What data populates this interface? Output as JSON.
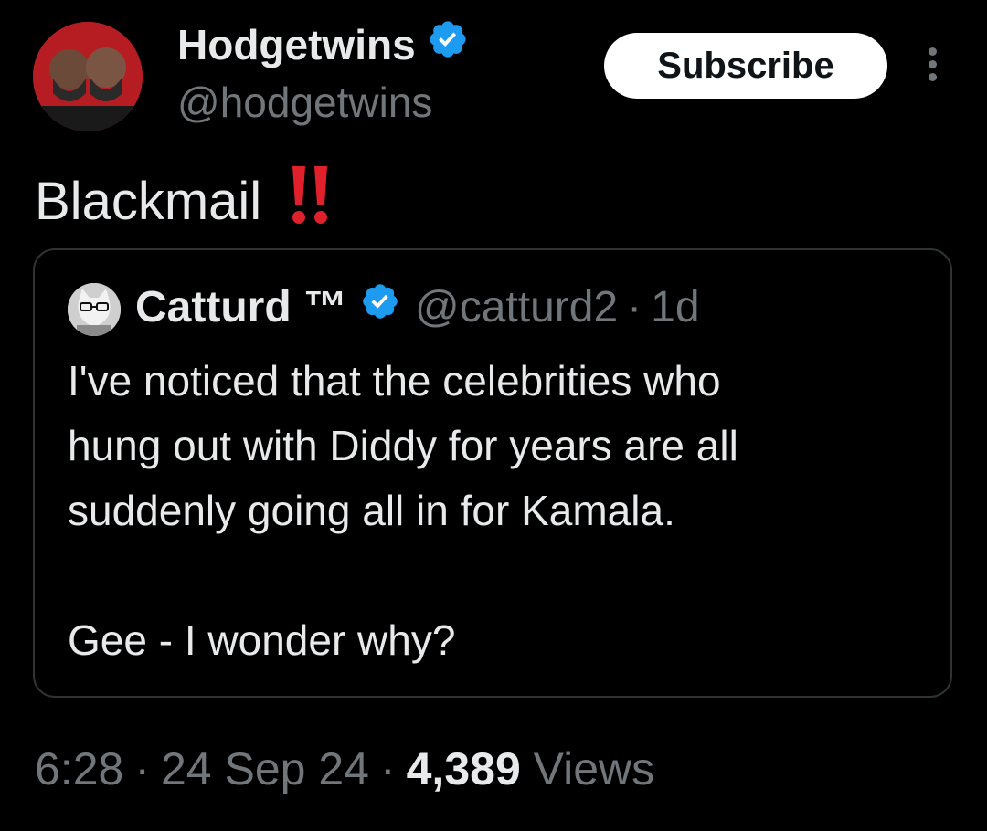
{
  "author": {
    "display_name": "Hodgetwins",
    "handle": "@hodgetwins",
    "verified_icon": "verified-badge-icon",
    "avatar_icon": "avatar-photo"
  },
  "actions": {
    "subscribe_label": "Subscribe",
    "more_icon": "more-vertical-icon"
  },
  "tweet": {
    "text": "Blackmail",
    "emoji_icon": "double-exclamation-icon"
  },
  "quote": {
    "display_name": "Catturd ™",
    "handle": "@catturd2",
    "separator": "·",
    "time": "1d",
    "lines": [
      "I've noticed that the celebrities who",
      "hung out with Diddy for years are all",
      "suddenly going all in for Kamala.",
      "Gee - I wonder why?"
    ]
  },
  "meta": {
    "time": "6:28",
    "date": "24 Sep 24",
    "views_count": "4,389",
    "views_label": "Views",
    "separator": "·"
  },
  "colors": {
    "background": "#000000",
    "text": "#e7e9ea",
    "secondary": "#71767b",
    "verified": "#1d9bf0",
    "border": "#2f3336",
    "emoji": "#e0202a"
  }
}
